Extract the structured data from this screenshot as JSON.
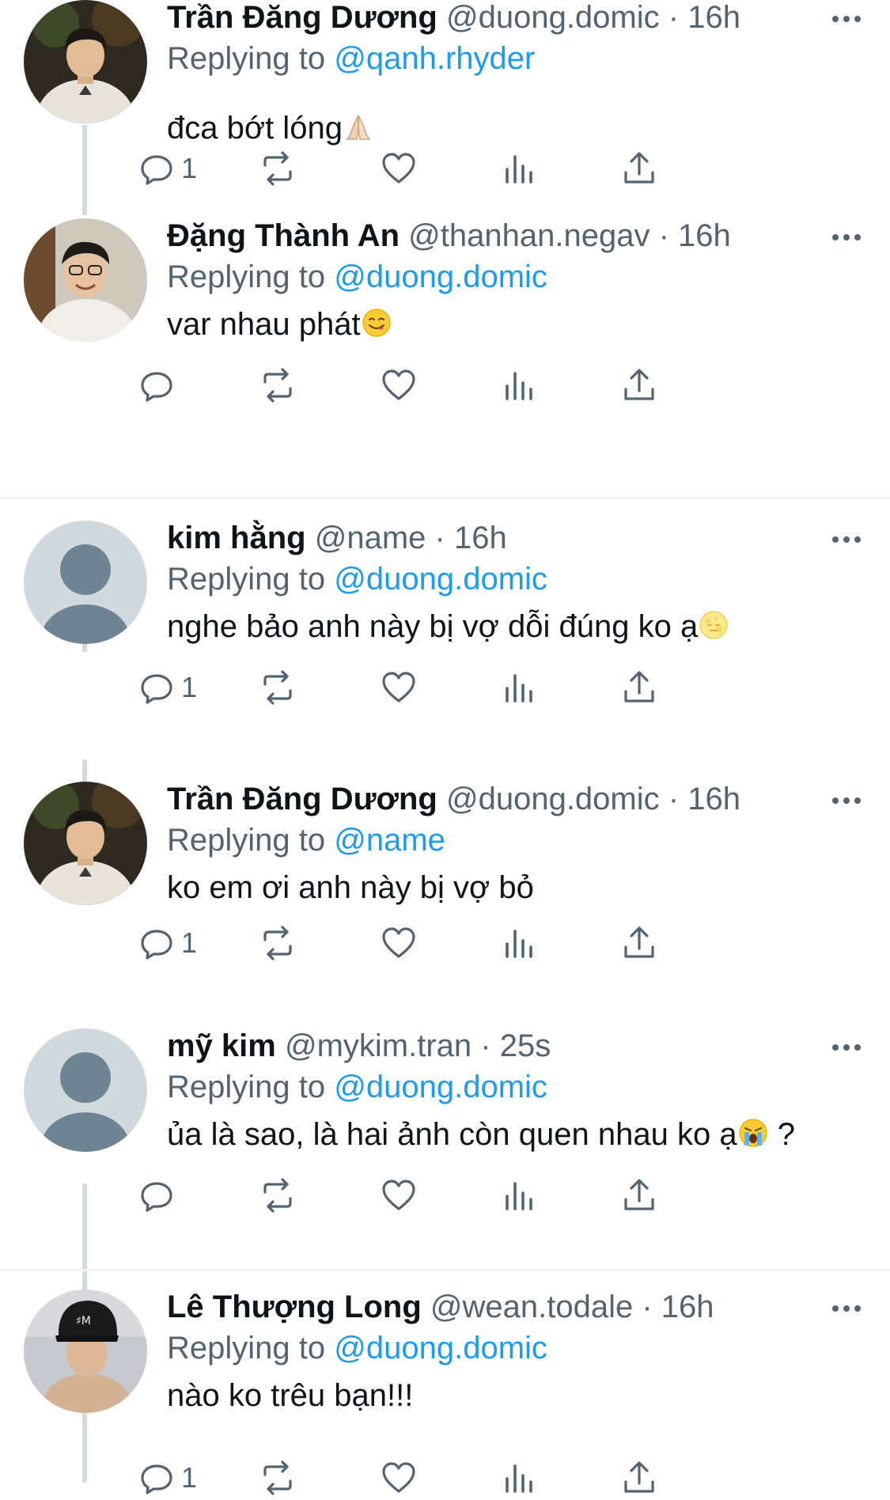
{
  "tweets": [
    {
      "name": "Trần Đăng Dương",
      "handle": "@duong.domic",
      "time": "· 16h",
      "replying_label": "Replying to",
      "replying_to": "@qanh.rhyder",
      "text": "đca bớt lóng",
      "emoji": "folded-hands",
      "reply_count": "1",
      "avatar": "photo-young-man-white-shirt"
    },
    {
      "name": "Đặng Thành An",
      "handle": "@thanhan.negav",
      "time": "· 16h",
      "replying_label": "Replying to",
      "replying_to": "@duong.domic",
      "text": "var nhau phát",
      "emoji": "yum-face",
      "reply_count": "",
      "avatar": "photo-smiling-man-glasses"
    },
    {
      "name": "kim hằng",
      "handle": "@name",
      "time": "· 16h",
      "replying_label": "Replying to",
      "replying_to": "@duong.domic",
      "text": "nghe bảo anh này bị vợ dỗi đúng ko ạ",
      "emoji": "moon-face",
      "reply_count": "1",
      "avatar": "default-avatar"
    },
    {
      "name": "Trần Đăng Dương",
      "handle": "@duong.domic",
      "time": "· 16h",
      "replying_label": "Replying to",
      "replying_to": "@name",
      "text": "ko em ơi anh này bị vợ bỏ",
      "emoji": "",
      "reply_count": "1",
      "avatar": "photo-young-man-white-shirt"
    },
    {
      "name": "mỹ kim",
      "handle": "@mykim.tran",
      "time": "· 25s",
      "replying_label": "Replying to",
      "replying_to": "@duong.domic",
      "text": "ủa là sao, là hai ảnh còn quen nhau ko ạ",
      "emoji": "crying-face",
      "text_suffix": " ?",
      "reply_count": "",
      "avatar": "default-avatar"
    },
    {
      "name": "Lê Thượng Long",
      "handle": "@wean.todale",
      "time": "· 16h",
      "replying_label": "Replying to",
      "replying_to": "@duong.domic",
      "text": "nào ko trêu bạn!!!",
      "emoji": "",
      "reply_count": "1",
      "avatar": "photo-man-black-cap"
    }
  ],
  "icons": {
    "reply": "reply-icon",
    "retweet": "retweet-icon",
    "like": "like-icon",
    "views": "views-icon",
    "share": "share-icon",
    "more": "more-icon"
  },
  "colors": {
    "link": "#1d9bf0",
    "secondary": "#536471",
    "text": "#0f1419",
    "thread_line": "#cfd9de",
    "separator": "#eff3f4"
  }
}
